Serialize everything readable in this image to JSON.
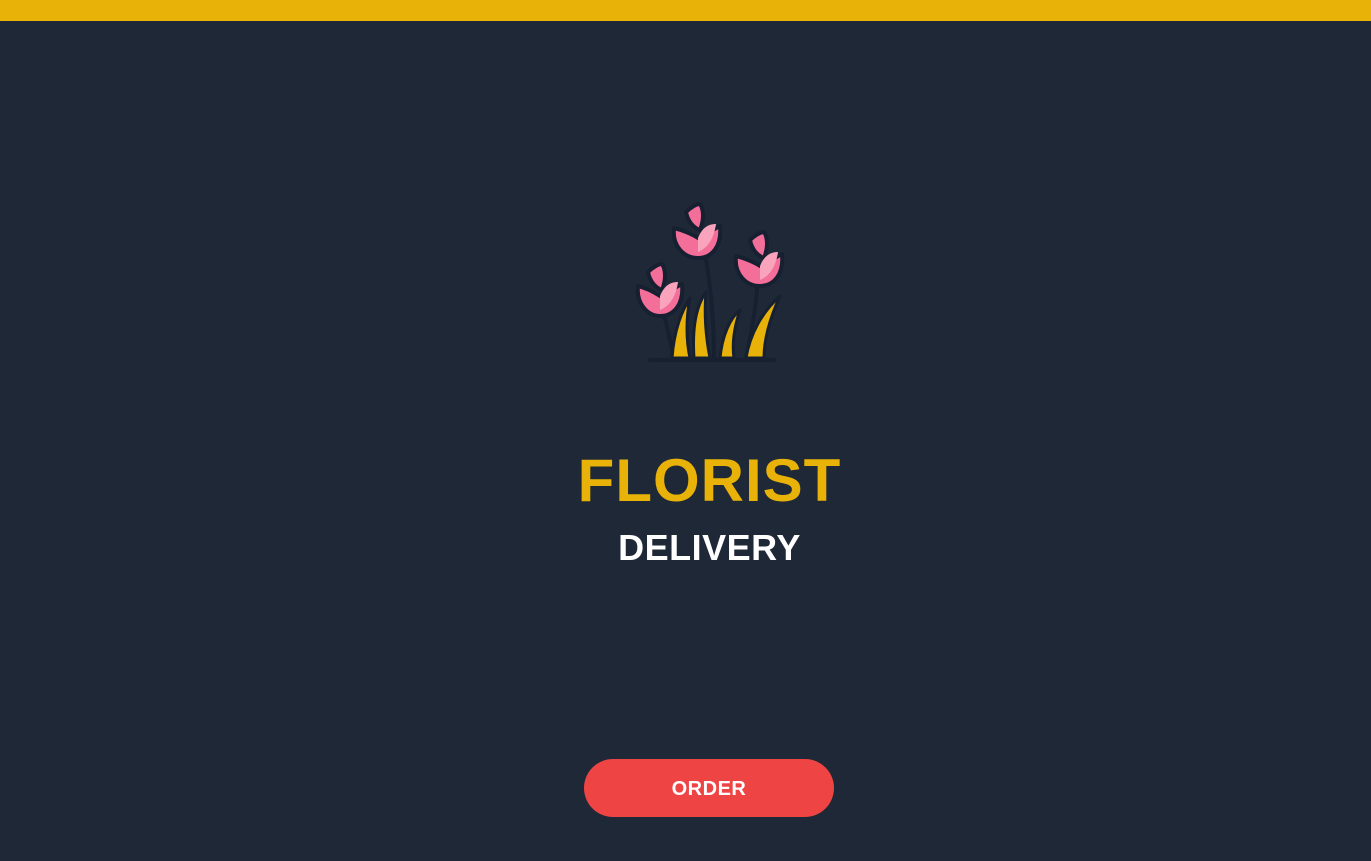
{
  "header": {
    "bar_color": "#e9b208"
  },
  "logo": {
    "icon": "tulips-icon",
    "petal_color": "#f46e9a",
    "leaf_color": "#e9b208",
    "outline_color": "#172030"
  },
  "brand": {
    "title": "FLORIST",
    "subtitle": "DELIVERY",
    "title_color": "#e9b208",
    "subtitle_color": "#ffffff"
  },
  "cta": {
    "order_label": "ORDER",
    "button_color": "#ef4444"
  },
  "colors": {
    "background": "#1f2837"
  }
}
